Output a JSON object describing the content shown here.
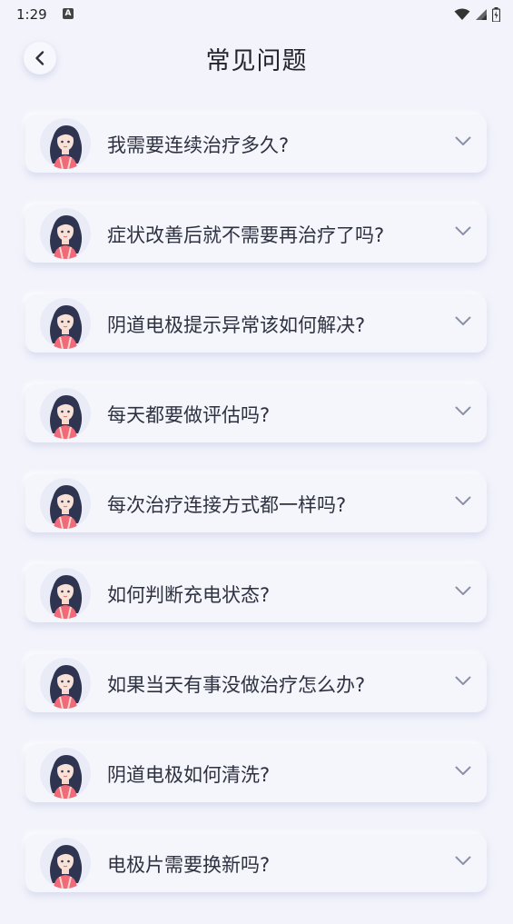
{
  "status": {
    "time": "1:29",
    "notif_icon": "A"
  },
  "header": {
    "title": "常见问题",
    "back_icon": "chevron-left-icon"
  },
  "faq": [
    {
      "question": "我需要连续治疗多久?"
    },
    {
      "question": "症状改善后就不需要再治疗了吗?"
    },
    {
      "question": "阴道电极提示异常该如何解决?"
    },
    {
      "question": "每天都要做评估吗?"
    },
    {
      "question": "每次治疗连接方式都一样吗?"
    },
    {
      "question": "如何判断充电状态?"
    },
    {
      "question": "如果当天有事没做治疗怎么办?"
    },
    {
      "question": "阴道电极如何清洗?"
    },
    {
      "question": "电极片需要换新吗?"
    }
  ],
  "colors": {
    "background": "#f2f3fb",
    "card": "#f5f6fc",
    "hair": "#2f3550",
    "shirt": "#f06a7a",
    "chevron": "#8a90a8"
  }
}
